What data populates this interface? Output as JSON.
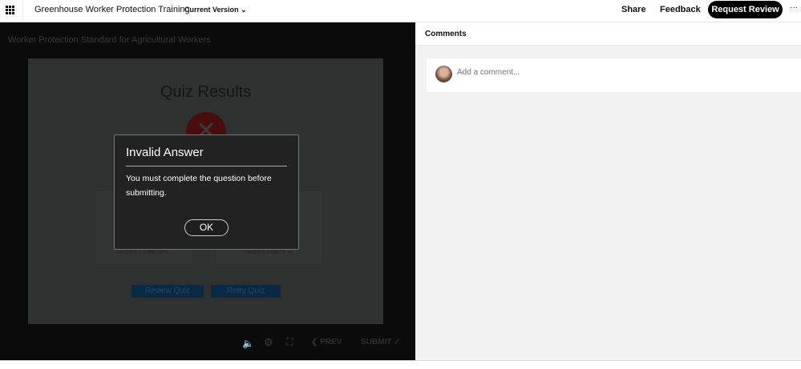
{
  "header": {
    "title": "Greenhouse Worker Protection Training",
    "version": "Current Version",
    "share": "Share",
    "feedback": "Feedback",
    "request_review": "Request Review",
    "more": "···"
  },
  "player": {
    "course_title": "Worker Protection Standard for Agricultural Workers",
    "slide": {
      "title": "Quiz Results",
      "passing_score": "PASSING SCORE: 80%",
      "passing_points": "PASSING POINTS: 40",
      "review_quiz": "Review Quiz",
      "retry_quiz": "Retry Quiz"
    },
    "controls": {
      "prev": "PREV",
      "submit": "SUBMIT"
    },
    "dialog": {
      "title": "Invalid Answer",
      "message": "You must complete the question before submitting.",
      "ok": "OK"
    }
  },
  "comments": {
    "title": "Comments",
    "placeholder": "Add a comment..."
  }
}
